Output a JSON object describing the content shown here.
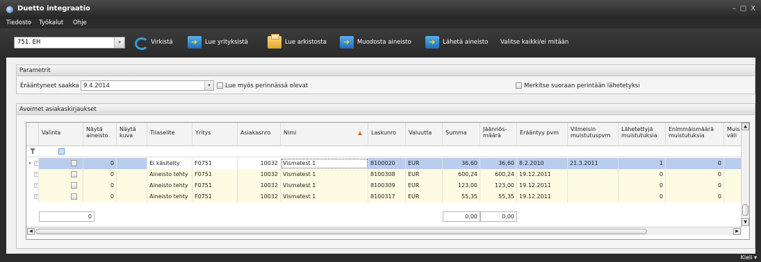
{
  "window": {
    "title": "Duetto integraatio"
  },
  "menu": [
    "Tiedosto",
    "Työkalut",
    "Ohje"
  ],
  "toolbar": {
    "company_combo_value": "751. EH",
    "refresh": "Virkistä",
    "read_companies": "Lue yrityksistä",
    "read_archive": "Lue arkistosta",
    "build_material": "Muodosta aineisto",
    "send_material": "Lähetä aineisto",
    "select_all": "Valitse kaikki/ei mitään"
  },
  "parameters": {
    "panel_title": "Parametrit",
    "due_label": "Erääntyneet saakka",
    "due_value": "9.4.2014",
    "read_collection_label": "Lue myös perinnässä olevat",
    "mark_sent_label": "Merkitse suoraan perintään lähetetyksi"
  },
  "grid": {
    "panel_title": "Avoimet asiakaskirjaukset",
    "columns": [
      "Valinta",
      "Näytä aineisto",
      "Näytä kuva",
      "Tilaselite",
      "Yritys",
      "Asiakasnro",
      "Nimi",
      "Laskunro",
      "Valuutta",
      "Summa",
      "Jäännös-määrä",
      "Erääntyy pvm",
      "Viimeisin muistutuspvm",
      "Lähetettyjä muistutuksia",
      "Enimmäismäärä muistutuksia",
      "Muis väli"
    ],
    "rows": [
      {
        "nayta": "0",
        "tila": "Ei käsitelty",
        "yritys": "F0751",
        "asiakasnro": "10032",
        "nimi": "Vismatest 1",
        "laskunro": "8100020",
        "valuutta": "EUR",
        "summa": "36,60",
        "jaannos": "36,60",
        "erapvm": "8.2.2010",
        "viimeisin": "21.3.2011",
        "lahetetty": "1",
        "enimmais": "0"
      },
      {
        "nayta": "0",
        "tila": "Aineisto tehty",
        "yritys": "F0751",
        "asiakasnro": "10032",
        "nimi": "Vismatest 1",
        "laskunro": "8100308",
        "valuutta": "EUR",
        "summa": "600,24",
        "jaannos": "600,24",
        "erapvm": "19.12.2011",
        "viimeisin": "",
        "lahetetty": "0",
        "enimmais": "0"
      },
      {
        "nayta": "0",
        "tila": "Aineisto tehty",
        "yritys": "F0751",
        "asiakasnro": "10032",
        "nimi": "Vismatest 1",
        "laskunro": "8100309",
        "valuutta": "EUR",
        "summa": "123,00",
        "jaannos": "123,00",
        "erapvm": "19.12.2011",
        "viimeisin": "",
        "lahetetty": "0",
        "enimmais": "0"
      },
      {
        "nayta": "0",
        "tila": "Aineisto tehty",
        "yritys": "F0751",
        "asiakasnro": "10032",
        "nimi": "Vismatest 1",
        "laskunro": "8100317",
        "valuutta": "EUR",
        "summa": "55,35",
        "jaannos": "55,35",
        "erapvm": "19.12.2011",
        "viimeisin": "",
        "lahetetty": "0",
        "enimmais": "0"
      }
    ],
    "totals": {
      "nayta": "0",
      "summa": "0,00",
      "jaannos": "0,00"
    }
  },
  "status": {
    "language": "Kieli ▾"
  },
  "colors": {
    "selected_row": "#b9cdef",
    "data_row": "#fdfbe2",
    "accent": "#3a9ad9"
  }
}
